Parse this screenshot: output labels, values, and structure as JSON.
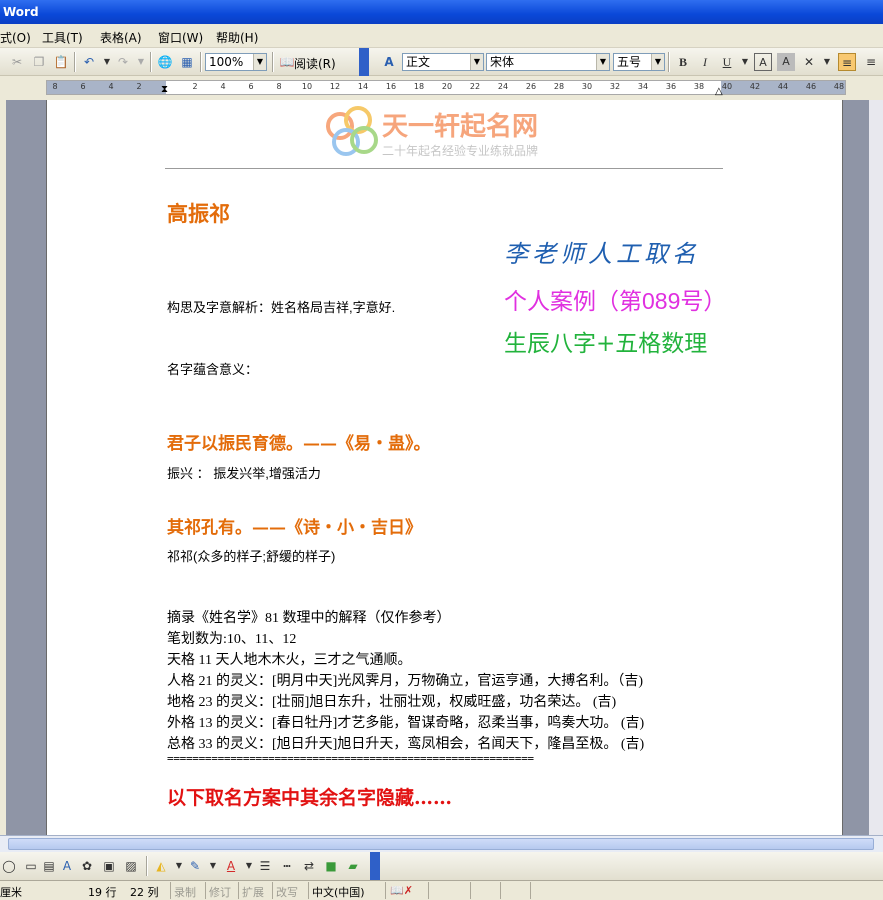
{
  "window": {
    "title": "Word"
  },
  "menu": [
    "式(O)",
    "工具(T)",
    "表格(A)",
    "窗口(W)",
    "帮助(H)"
  ],
  "toolbar": {
    "zoom": "100%",
    "read_label": "阅读(R)",
    "style": "正文",
    "font": "宋体",
    "size": "五号",
    "bold": "B",
    "italic": "I",
    "underline": "U"
  },
  "ruler": {
    "ticks": [
      "8",
      "6",
      "4",
      "2",
      "2",
      "4",
      "6",
      "8",
      "10",
      "12",
      "14",
      "16",
      "18",
      "20",
      "22",
      "24",
      "26",
      "28",
      "30",
      "32",
      "34",
      "36",
      "38",
      "40",
      "42",
      "44",
      "46",
      "48"
    ]
  },
  "logo": {
    "name": "天一轩起名网",
    "slogan": "二十年起名经验专业练就品牌"
  },
  "document": {
    "name": "高振祁",
    "analysis": "构思及字意解析：姓名格局吉祥,字意好.",
    "meaning_label": "名字蕴含意义：",
    "quote1": "君子以振民育德。——《易・蛊》。",
    "explain1": "振兴 ：  振发兴举,增强活力",
    "quote2": "其祁孔有。——《诗・小・吉日》",
    "explain2": "祁祁(众多的样子;舒缓的样子)",
    "lines": [
      "摘录《姓名学》81 数理中的解释（仅作参考）",
      "笔划数为:10、11、12",
      "天格 11 天人地木木火，三才之气通顺。",
      "人格 21 的灵义：[明月中天]光风霁月，万物确立，官运亨通，大搏名利。（吉)",
      "地格 23 的灵义：[壮丽]旭日东升，壮丽壮观，权威旺盛，功名荣达。 (吉)",
      "外格 13 的灵义：[春日牡丹]才艺多能，智谋奇略，忍柔当事，鸣奏大功。 (吉)",
      "总格 33 的灵义：[旭日升天]旭日升天，鸾凤相会，名闻天下，隆昌至极。 (吉)"
    ],
    "divider": "==========================================================",
    "footer": "以下取名方案中其余名字隐藏……"
  },
  "overlay": {
    "line1": "李老师人工取名",
    "line2": "个人案例（第089号）",
    "line3": "生辰八字+五格数理"
  },
  "status": {
    "unit": "厘米",
    "row": "19 行",
    "col": "22 列",
    "rec": "录制",
    "trk": "修订",
    "ext": "扩展",
    "ovr": "改写",
    "lang": "中文(中国)"
  },
  "colors": {
    "title_blue": "#0a48d8",
    "accent_orange": "#e36c0a",
    "magenta": "#e030e0",
    "green": "#22b33c",
    "red": "#e21212"
  }
}
